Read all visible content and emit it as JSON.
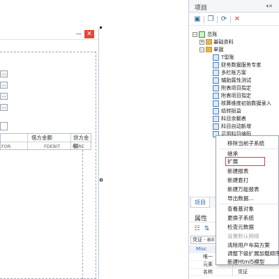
{
  "dialog": {
    "close_glyph": "✕",
    "minimize_glyph": "—",
    "combo_glyph": "...",
    "grid": {
      "headers": [
        "",
        "借方金额",
        "贷方金额"
      ],
      "subheaders": [
        "FOR",
        "FDEBIT",
        "FCRE"
      ]
    }
  },
  "panel": {
    "title": "项目",
    "tree": {
      "root": "总账",
      "nodes": [
        {
          "label": "基础资料",
          "level": 1
        },
        {
          "label": "单据",
          "level": 1
        },
        {
          "label": "T型账",
          "level": 2
        },
        {
          "label": "财务数据服务专家",
          "level": 2
        },
        {
          "label": "多栏账方案",
          "level": 2
        },
        {
          "label": "辅助属性测试",
          "level": 2
        },
        {
          "label": "附表项目指定",
          "level": 2
        },
        {
          "label": "附表项目指定",
          "level": 2
        },
        {
          "label": "核算维度初始数据录入",
          "level": 2
        },
        {
          "label": "结转损益",
          "level": 2
        },
        {
          "label": "科目余额表",
          "level": 2
        },
        {
          "label": "科目自动新增",
          "level": 2
        },
        {
          "label": "可用科目编码",
          "level": 2
        }
      ]
    },
    "tab_label": "项目",
    "props_title": "属性",
    "props_selected": "凭证 - Bill",
    "props_category": "Misc",
    "props_rows": [
      {
        "key": "唯一",
        "value": ""
      },
      {
        "key": "元素",
        "value": ""
      },
      {
        "key": "名称",
        "value": "凭证"
      }
    ]
  },
  "context_menu": {
    "items": [
      "移除当前子系统",
      "继承",
      "扩展",
      "新建报表",
      "新建套打",
      "新建万能报表",
      "导出数据...",
      "查看基对象",
      "更换子系统",
      "检查元数据",
      "设置默认网络",
      "清除用户布局方案",
      "调整下级扩展加载顺序",
      "新建Html5模型"
    ],
    "highlighted": "扩展",
    "highlight_color": "#e03c3c"
  },
  "colors": {
    "accent": "#2d6aa6",
    "close_red": "#e5463b",
    "folder": "#e4b94a"
  },
  "icons": {
    "panel_pin": "pin-icon",
    "toolbar": [
      "new-icon",
      "copy-icon",
      "refresh-icon",
      "delete-icon"
    ],
    "props_toolbar": [
      "categorized-icon",
      "alphabetical-icon"
    ]
  }
}
